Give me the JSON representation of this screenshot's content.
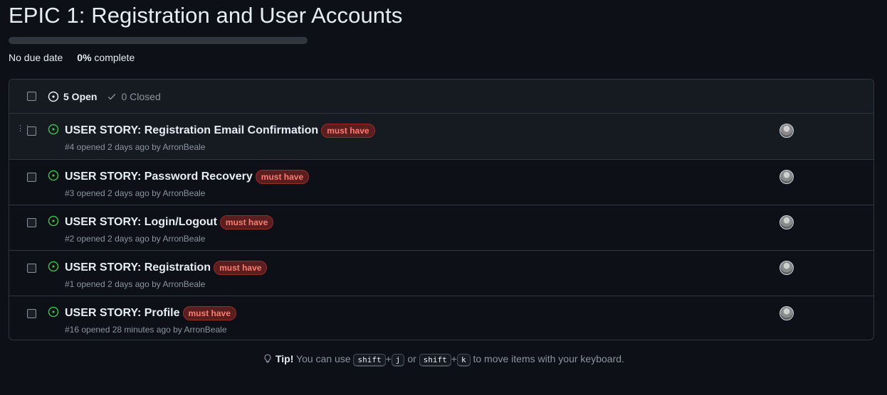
{
  "milestone": {
    "title": "EPIC 1: Registration and User Accounts",
    "due": "No due date",
    "percent": "0%",
    "percent_suffix": " complete",
    "progress_fraction": 0
  },
  "header": {
    "open_label": "5 Open",
    "closed_label": "0 Closed"
  },
  "issues": [
    {
      "title": "USER STORY: Registration Email Confirmation",
      "label": "must have",
      "meta": "#4 opened 2 days ago by ArronBeale"
    },
    {
      "title": "USER STORY: Password Recovery",
      "label": "must have",
      "meta": "#3 opened 2 days ago by ArronBeale"
    },
    {
      "title": "USER STORY: Login/Logout",
      "label": "must have",
      "meta": "#2 opened 2 days ago by ArronBeale"
    },
    {
      "title": "USER STORY: Registration",
      "label": "must have",
      "meta": "#1 opened 2 days ago by ArronBeale"
    },
    {
      "title": "USER STORY: Profile",
      "label": "must have",
      "meta": "#16 opened 28 minutes ago by ArronBeale"
    }
  ],
  "tip": {
    "bold": "Tip!",
    "text1": "You can use",
    "key1": "shift",
    "plus1": "+",
    "key2": "j",
    "or": "or",
    "key3": "shift",
    "plus2": "+",
    "key4": "k",
    "text2": "to move items with your keyboard."
  },
  "colors": {
    "open_icon": "#3fb950",
    "label_text": "#ff7b72",
    "label_bg": "#5a1e1e"
  }
}
